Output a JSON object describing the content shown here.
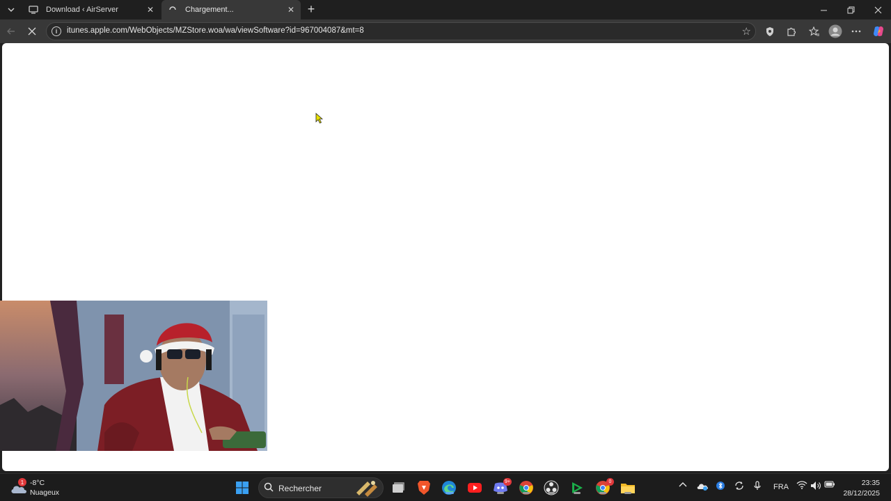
{
  "browser": {
    "tabs": [
      {
        "title": "Download ‹ AirServer"
      },
      {
        "title": "Chargement..."
      }
    ],
    "address_url": "itunes.apple.com/WebObjects/MZStore.woa/wa/viewSoftware?id=967004087&mt=8"
  },
  "taskbar": {
    "weather": {
      "temp": "-8°C",
      "condition": "Nuageux",
      "alert_count": "1"
    },
    "search_label": "Rechercher",
    "badges": {
      "discord": "9+",
      "chrome": "0"
    },
    "language": "FRA",
    "time": "23:35",
    "date": "28/12/2025"
  },
  "colors": {
    "edge_accent": "#2b7de9",
    "taskbar_bg": "#1c1c1c",
    "tab_active_bg": "#383838"
  }
}
